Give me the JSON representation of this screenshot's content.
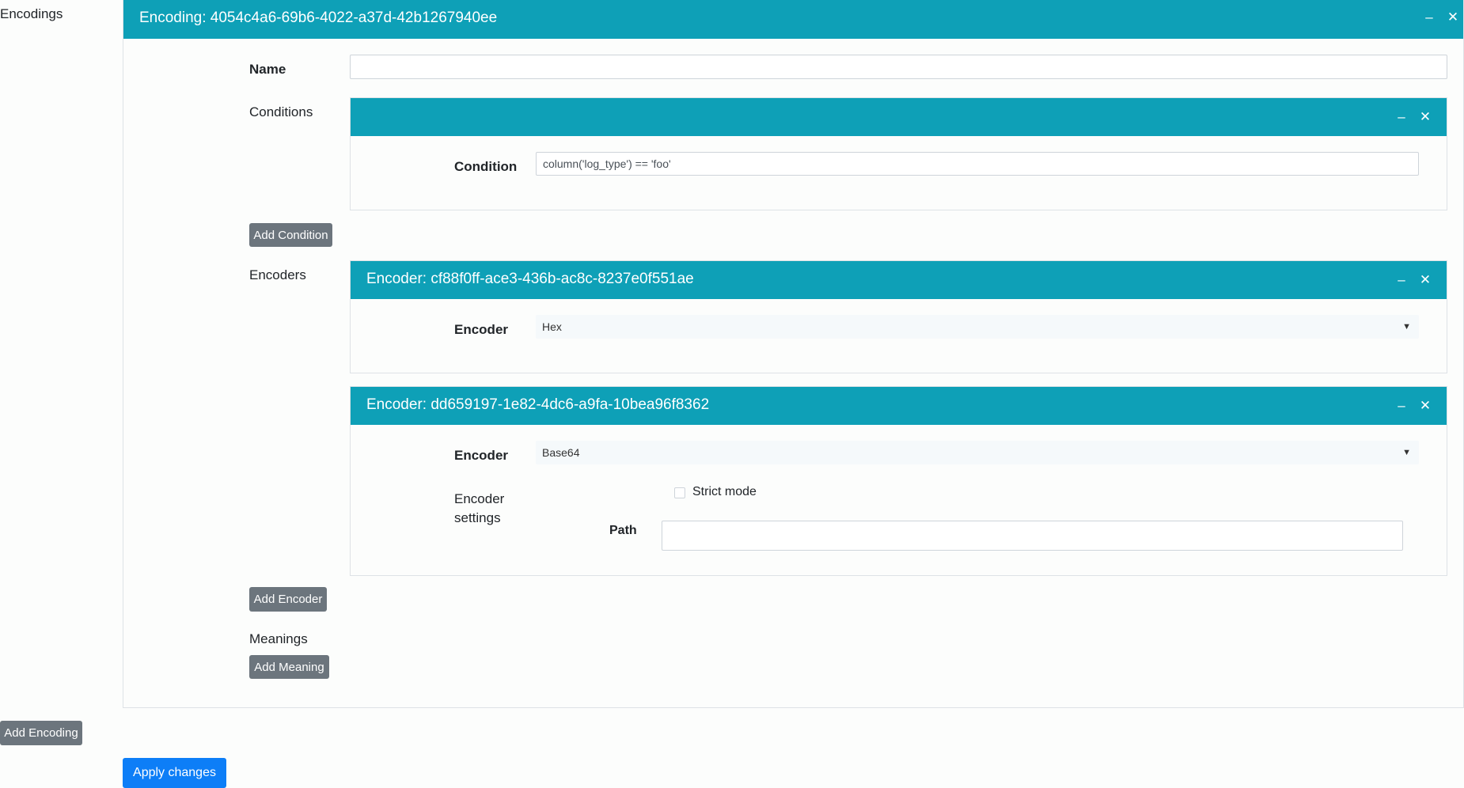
{
  "sidebar": {
    "title": "Encodings",
    "add_encoding": "Add Encoding"
  },
  "encoding": {
    "title": "Encoding: 4054c4a6-69b6-4022-a37d-42b1267940ee",
    "name_label": "Name",
    "name_value": "",
    "conditions_label": "Conditions",
    "condition": {
      "title": "",
      "label": "Condition",
      "value": "column('log_type') == 'foo'"
    },
    "add_condition": "Add Condition",
    "encoders_label": "Encoders",
    "encoders": [
      {
        "title": "Encoder: cf88f0ff-ace3-436b-ac8c-8237e0f551ae",
        "label": "Encoder",
        "selected": "Hex"
      },
      {
        "title": "Encoder: dd659197-1e82-4dc6-a9fa-10bea96f8362",
        "label": "Encoder",
        "selected": "Base64",
        "settings_label": "Encoder settings",
        "settings_line1": "Encoder",
        "settings_line2": "settings",
        "strict_mode_label": "Strict mode",
        "strict_mode_checked": false,
        "path_label": "Path",
        "path_value": ""
      }
    ],
    "add_encoder": "Add Encoder",
    "meanings_label": "Meanings",
    "add_meaning": "Add Meaning"
  },
  "icons": {
    "minimize": "minimize-icon",
    "close": "close-icon"
  },
  "actions": {
    "apply": "Apply changes"
  },
  "colors": {
    "header": "#0ea0b7",
    "primary": "#0d7ef7",
    "secondary": "#6c757d"
  }
}
